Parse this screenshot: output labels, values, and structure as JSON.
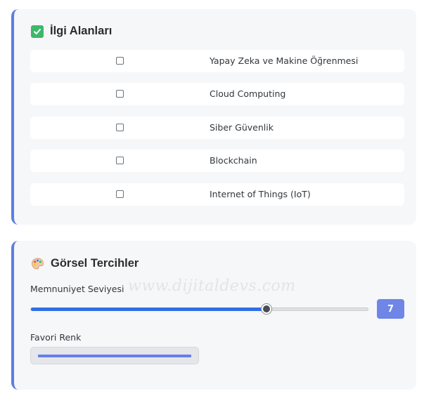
{
  "interests": {
    "title": "İlgi Alanları",
    "title_icon": "check-mark-button-icon",
    "items": [
      {
        "label": "Yapay Zeka ve Makine Öğrenmesi",
        "checked": false
      },
      {
        "label": "Cloud Computing",
        "checked": false
      },
      {
        "label": "Siber Güvenlik",
        "checked": false
      },
      {
        "label": "Blockchain",
        "checked": false
      },
      {
        "label": "Internet of Things (IoT)",
        "checked": false
      }
    ]
  },
  "visual_preferences": {
    "title": "Görsel Tercihler",
    "title_icon": "artist-palette-icon",
    "satisfaction": {
      "label": "Memnuniyet Seviyesi",
      "value": "7",
      "level_fraction": 0.7
    },
    "favorite_color": {
      "label": "Favori Renk",
      "value": "#667eea"
    }
  },
  "watermark": "www.dijitaldevs.com",
  "colors": {
    "accent_border": "#5b7fe0",
    "slider_fill": "#2f6fe8",
    "badge": "#6f86e6",
    "title_check": "#3db86b"
  }
}
